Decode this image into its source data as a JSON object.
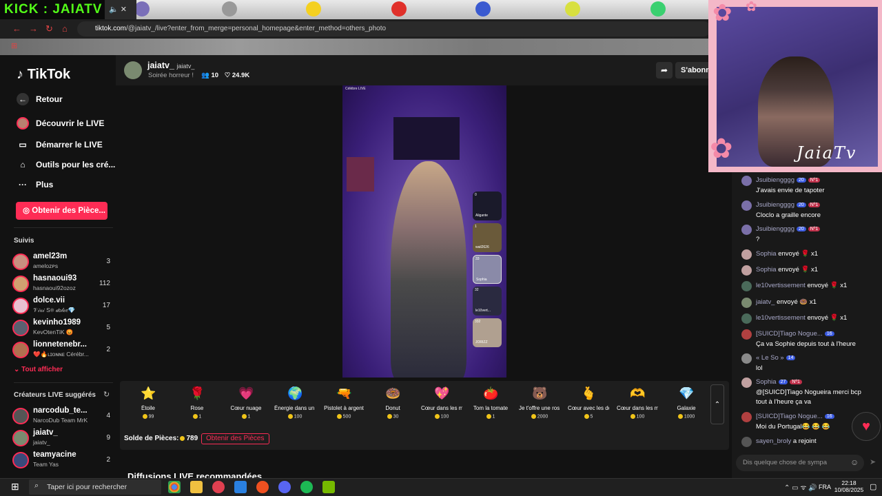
{
  "overlay": {
    "kick_label": "KICK : JAIATV"
  },
  "browser": {
    "url_host": "tiktok.com",
    "url_path": "/@jaiatv_/live?enter_from_merge=personal_homepage&enter_method=others_photo"
  },
  "sidebar": {
    "logo": "TikTok",
    "nav": [
      {
        "label": "Retour",
        "icon": "back-arrow-icon"
      },
      {
        "label": "Découvrir le LIVE",
        "icon": "live-avatar-icon"
      },
      {
        "label": "Démarrer le LIVE",
        "icon": "camera-icon"
      },
      {
        "label": "Outils pour les cré...",
        "icon": "home-tools-icon"
      },
      {
        "label": "Plus",
        "icon": "more-dots-icon"
      }
    ],
    "coins_button": "Obtenir des Pièce...",
    "followed_heading": "Suivis",
    "followed": [
      {
        "name": "amel23m",
        "sub": "amelᴏᴢᴘs",
        "count": "3"
      },
      {
        "name": "hasnaoui93",
        "sub": "hasnaoui92ᴏᴢᴏᴢ",
        "count": "112"
      },
      {
        "name": "dolce.vii",
        "sub": "𝒱𝒾𝓋𝒾 S❄ 𝒹𝑜𝓁𝒸𝑒💎",
        "count": "17"
      },
      {
        "name": "kevinho1989",
        "sub": "KevOtenTiK 😡",
        "count": "5"
      },
      {
        "name": "lionnetenebr...",
        "sub": "❤️🔥ʟɪᴏɴɴᴇ Cérébr...",
        "count": "2"
      }
    ],
    "show_all": "Tout afficher",
    "suggested_heading": "Créateurs LIVE suggérés",
    "suggested": [
      {
        "name": "narcodub_te...",
        "sub": "NarcoDub Team MrK",
        "count": "4"
      },
      {
        "name": "jaiatv_",
        "sub": "jaiatv_",
        "count": "9"
      },
      {
        "name": "teamyacine",
        "sub": "Team Yas",
        "count": "2"
      }
    ]
  },
  "live": {
    "host_name": "jaiatv_",
    "host_handle": "jaiatv_",
    "title": "Soirée horreur !",
    "viewers": "10",
    "likes": "24.9K",
    "follow_button": "S'abonner",
    "video_caption": "Célèbre LIVE",
    "side_tiles": [
      {
        "rank": "0",
        "name": "Aligante"
      },
      {
        "rank": "1",
        "name": "wail2626"
      },
      {
        "rank": "33",
        "name": "Sophia"
      },
      {
        "rank": "32",
        "name": "le10vert..."
      },
      {
        "rank": "332",
        "name": "JORIZZ"
      }
    ]
  },
  "gifts": [
    {
      "name": "Étoile",
      "price": "99",
      "icon": "⭐",
      "color": "#f5d020"
    },
    {
      "name": "Rose",
      "price": "1",
      "icon": "🌹",
      "color": "#e0203a"
    },
    {
      "name": "Cœur nuage",
      "price": "1",
      "icon": "💗",
      "color": "#f48fb8"
    },
    {
      "name": "Énergie dans un ...",
      "price": "100",
      "icon": "🌍",
      "color": "#2a9fd6"
    },
    {
      "name": "Pistolet à argent",
      "price": "500",
      "icon": "🔫",
      "color": "#e28bd6"
    },
    {
      "name": "Donut",
      "price": "30",
      "icon": "🍩",
      "color": "#f2a0b0"
    },
    {
      "name": "Cœur dans les m...",
      "price": "100",
      "icon": "💖",
      "color": "#e05a9a"
    },
    {
      "name": "Tom la tomate",
      "price": "1",
      "icon": "🍅",
      "color": "#e0452a"
    },
    {
      "name": "Je t'offre une ros...",
      "price": "2000",
      "icon": "🐻",
      "color": "#b5773a"
    },
    {
      "name": "Cœur avec les do...",
      "price": "5",
      "icon": "🫰",
      "color": "#f0a070"
    },
    {
      "name": "Cœur dans les m...",
      "price": "100",
      "icon": "🫶",
      "color": "#f0a070"
    },
    {
      "name": "Galaxie",
      "price": "1000",
      "icon": "💎",
      "color": "#6a8af0"
    }
  ],
  "balance": {
    "label": "Solde de Pièces:",
    "amount": "789",
    "button": "Obtenir des Pièces"
  },
  "recommended_heading": "Diffusions LIVE recommandées",
  "chat": [
    {
      "who": "Jsuibiengggg",
      "badges": [
        "20",
        "Nº1"
      ],
      "text": "J'avais envie de tapoter"
    },
    {
      "who": "Jsuibiengggg",
      "badges": [
        "20",
        "Nº1"
      ],
      "text": "Cloclo a graille encore"
    },
    {
      "who": "Jsuibiengggg",
      "badges": [
        "20",
        "Nº1"
      ],
      "text": "?"
    },
    {
      "who": "Sophia",
      "text": "envoyé 🌹 x1",
      "single": true
    },
    {
      "who": "Sophia",
      "text": "envoyé 🌹 x1",
      "single": true
    },
    {
      "who": "le10vertissement",
      "text": "envoyé 🌹 x1",
      "single": true
    },
    {
      "who": "jaiatv_",
      "text": "envoyé 🍩 x1",
      "single": true
    },
    {
      "who": "le10vertissement",
      "text": "envoyé 🌹 x1",
      "single": true
    },
    {
      "who": "[SUICD]Tiago Nogue...",
      "badges": [
        "16"
      ],
      "text": "Ça va Sophie depuis tout à l'heure"
    },
    {
      "who": "« Le So »",
      "badges": [
        "14"
      ],
      "text": "lol"
    },
    {
      "who": "Sophia",
      "badges": [
        "27",
        "Nº1"
      ],
      "text": "@[SUICD]Tiago Nogueira merci bcp"
    },
    {
      "who": "[SUICD]Tiago Nogue...",
      "badges": [
        "16"
      ],
      "text": "Moi du Portugal😂 😂 😂"
    },
    {
      "who": "sayen_broly",
      "text": "a rejoint",
      "single": true
    }
  ],
  "chat_extra_line": "tout à l'heure ça va",
  "chat_input_placeholder": "Dis quelque chose de sympa",
  "webcam_label": "JaiaTv",
  "taskbar": {
    "search_placeholder": "Taper ici pour rechercher",
    "lang": "FRA",
    "time": "22:18",
    "date": "10/08/2025"
  }
}
